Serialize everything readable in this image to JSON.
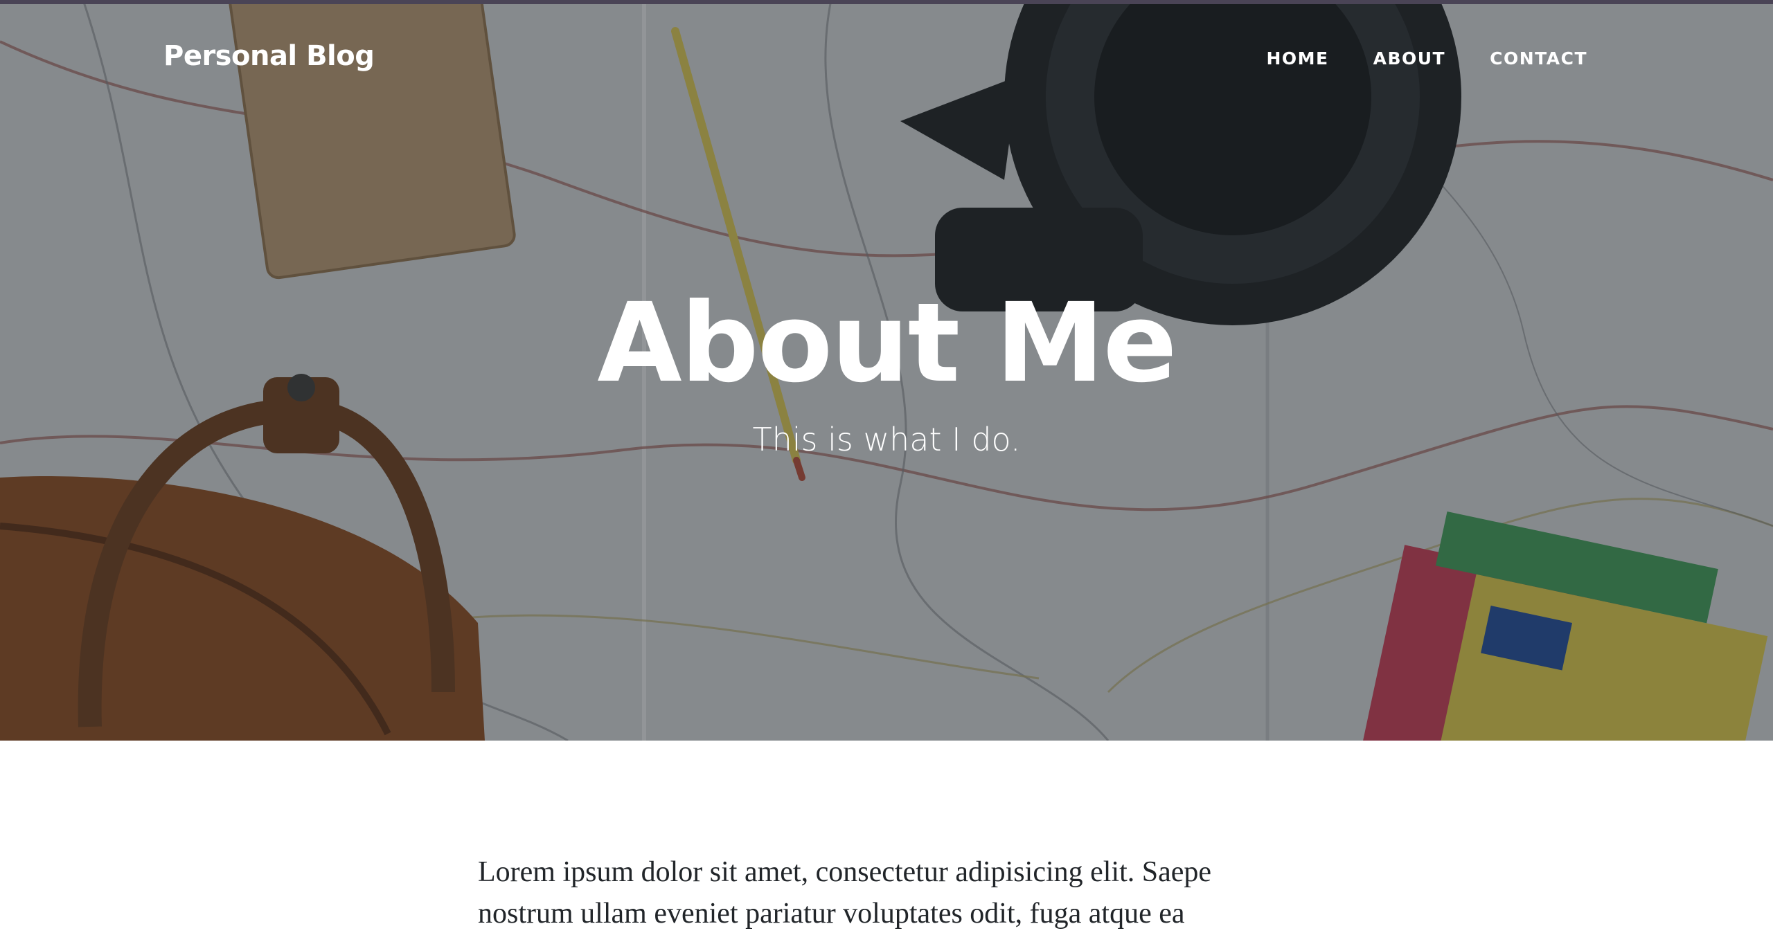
{
  "navbar": {
    "brand": "Personal Blog",
    "links": [
      "HOME",
      "ABOUT",
      "CONTACT"
    ]
  },
  "header": {
    "title": "About Me",
    "subtitle": "This is what I do."
  },
  "content": {
    "paragraph": "Lorem ipsum dolor sit amet, consectetur adipisicing elit. Saepe nostrum ullam eveniet pariatur voluptates odit, fuga atque ea"
  },
  "colors": {
    "overlay": "#212529",
    "text_light": "#ffffff",
    "text_dark": "#212529",
    "top_border": "#4a4456"
  },
  "icons": [
    "hero-background-image"
  ]
}
